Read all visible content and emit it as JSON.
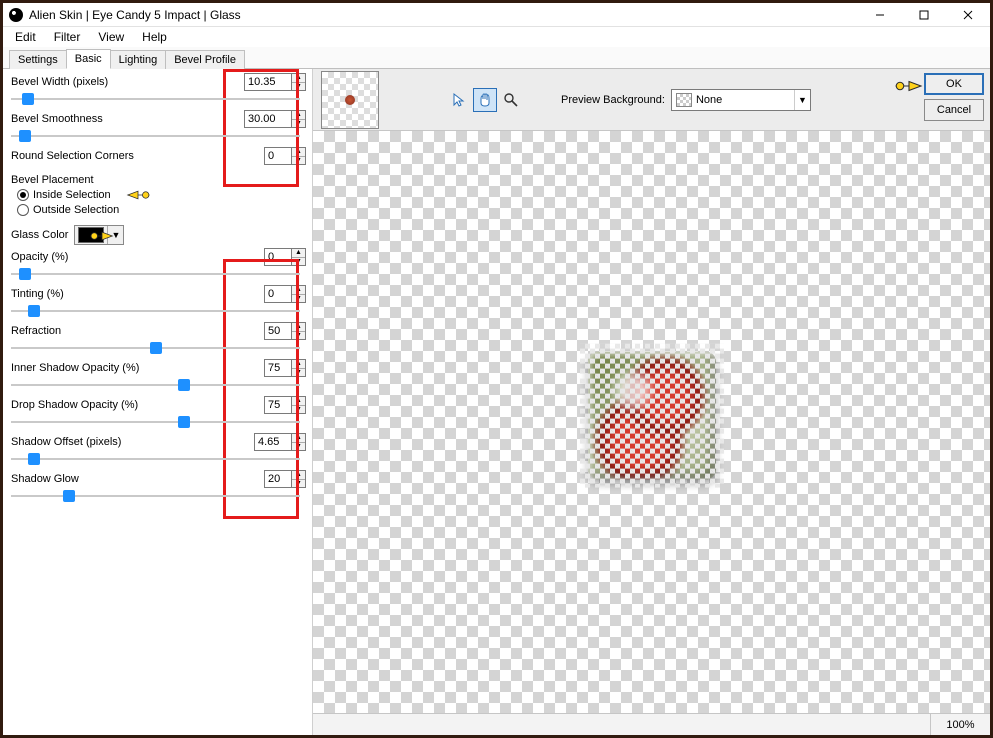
{
  "title": "Alien Skin | Eye Candy 5 Impact | Glass",
  "menu": {
    "edit": "Edit",
    "filter": "Filter",
    "view": "View",
    "help": "Help"
  },
  "tabs": {
    "settings": "Settings",
    "basic": "Basic",
    "lighting": "Lighting",
    "bevel": "Bevel Profile"
  },
  "sliders": {
    "bevelWidth": {
      "label": "Bevel Width (pixels)",
      "value": "10.35",
      "pos": 6
    },
    "bevelSmoothness": {
      "label": "Bevel Smoothness",
      "value": "30.00",
      "pos": 5
    },
    "roundCorners": {
      "label": "Round Selection Corners",
      "value": "0",
      "pos": 0
    },
    "opacity": {
      "label": "Opacity (%)",
      "value": "0",
      "pos": 5
    },
    "tinting": {
      "label": "Tinting (%)",
      "value": "0",
      "pos": 8
    },
    "refraction": {
      "label": "Refraction",
      "value": "50",
      "pos": 50
    },
    "innerShadow": {
      "label": "Inner Shadow Opacity (%)",
      "value": "75",
      "pos": 60
    },
    "dropShadow": {
      "label": "Drop Shadow Opacity (%)",
      "value": "75",
      "pos": 60
    },
    "shadowOffset": {
      "label": "Shadow Offset (pixels)",
      "value": "4.65",
      "pos": 8
    },
    "shadowGlow": {
      "label": "Shadow Glow",
      "value": "20",
      "pos": 20
    }
  },
  "bevelPlacement": {
    "label": "Bevel Placement",
    "inside": "Inside Selection",
    "outside": "Outside Selection"
  },
  "glassColor": {
    "label": "Glass Color"
  },
  "previewBackground": {
    "label": "Preview Background:",
    "value": "None"
  },
  "buttons": {
    "ok": "OK",
    "cancel": "Cancel"
  },
  "zoom": "100%"
}
